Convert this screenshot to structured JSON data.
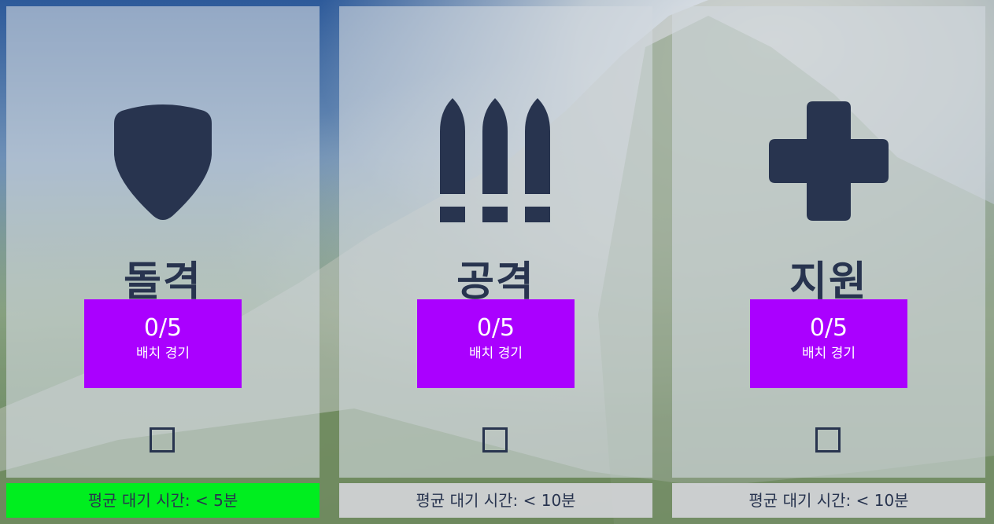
{
  "roles": [
    {
      "name": "돌격",
      "icon": "shield-icon",
      "placement_count": "0/5",
      "placement_label": "배치 경기",
      "wait_time": "평균 대기 시간: < 5분",
      "wait_color": "#00ee1f"
    },
    {
      "name": "공격",
      "icon": "bullets-icon",
      "placement_count": "0/5",
      "placement_label": "배치 경기",
      "wait_time": "평균 대기 시간: < 10분",
      "wait_color": "#d2d4d8"
    },
    {
      "name": "지원",
      "icon": "plus-cross-icon",
      "placement_count": "0/5",
      "placement_label": "배치 경기",
      "wait_time": "평균 대기 시간: < 10분",
      "wait_color": "#d2d4d8"
    }
  ],
  "colors": {
    "accent": "#aa00ff",
    "text_dark": "#28344f",
    "wait_fast": "#00ee1f"
  }
}
